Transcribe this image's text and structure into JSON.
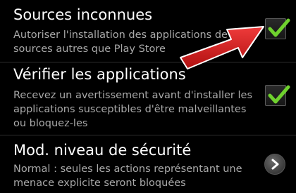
{
  "settings": {
    "items": [
      {
        "title": "Sources inconnues",
        "summary": "Autoriser l'installation des applications de sources autres que Play Store",
        "control": "checkbox",
        "checked": true
      },
      {
        "title": "Vérifier les applications",
        "summary": "Recevez un avertissement avant d'installer les applications susceptibles d'être malveillantes ou bloquez-les",
        "control": "checkbox",
        "checked": true
      },
      {
        "title": "Mod. niveau de sécurité",
        "summary": "Normal : seules les actions représentant une menace explicite seront bloquées",
        "control": "chevron"
      }
    ]
  },
  "icons": {
    "check": "check-icon",
    "chevron": "chevron-right-icon",
    "annotation": "red-arrow-icon"
  },
  "colors": {
    "background": "#000000",
    "title": "#ffffff",
    "summary": "#a9a9a9",
    "check": "#6fd12e",
    "arrow": "#d42020"
  }
}
